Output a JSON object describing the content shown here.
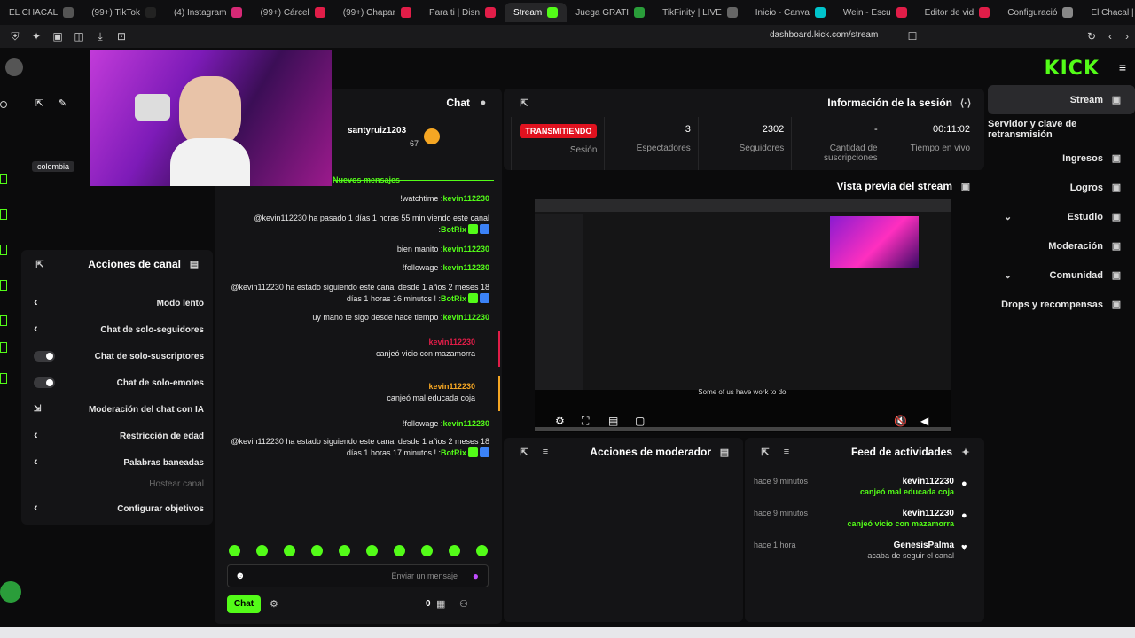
{
  "browser": {
    "tabs": [
      {
        "label": "EL CHACAL",
        "color": "#555555"
      },
      {
        "label": "(99+) TikTok",
        "color": "#222222"
      },
      {
        "label": "(4) Instagram",
        "color": "#d62976"
      },
      {
        "label": "(99+) Cárcel",
        "color": "#e11d48"
      },
      {
        "label": "(99+) Chapar",
        "color": "#e11d48"
      },
      {
        "label": "Para ti | Disn",
        "color": "#e11d48"
      },
      {
        "label": "Stream",
        "color": "#53fc18",
        "active": true
      },
      {
        "label": "Juega GRATI",
        "color": "#2a9d3a"
      },
      {
        "label": "TikFinity | LIVE",
        "color": "#666666"
      },
      {
        "label": "Inicio - Canva",
        "color": "#00c4cc"
      },
      {
        "label": "Wein - Escu",
        "color": "#e11d48"
      },
      {
        "label": "Editor de vid",
        "color": "#e11d48"
      },
      {
        "label": "Configuració",
        "color": "#888888"
      },
      {
        "label": "El Chacal | D",
        "color": "#888888"
      }
    ],
    "url": "dashboard.kick.com/stream"
  },
  "header": {
    "logo": "KICK"
  },
  "nav": {
    "items": [
      {
        "label": "Stream",
        "icon": "broadcast-icon",
        "active": true
      },
      {
        "label": "Servidor y clave de retransmisión",
        "icon": "",
        "active": false
      },
      {
        "label": "Ingresos",
        "icon": "money-icon"
      },
      {
        "label": "Logros",
        "icon": "trophy-icon"
      },
      {
        "label": "Estudio",
        "icon": "studio-icon",
        "chevron": true
      },
      {
        "label": "Moderación",
        "icon": "wrench-icon"
      },
      {
        "label": "Comunidad",
        "icon": "community-icon",
        "chevron": true
      },
      {
        "label": "Drops y recompensas",
        "icon": "gift-icon"
      }
    ]
  },
  "session": {
    "title": "Información de la sesión",
    "live_badge": "TRANSMITIENDO",
    "stats": [
      {
        "value": "",
        "label": "Sesión"
      },
      {
        "value": "3",
        "label": "Espectadores"
      },
      {
        "value": "2302",
        "label": "Seguidores"
      },
      {
        "value": "-",
        "label": "Cantidad de suscripciones"
      },
      {
        "value": "00:11:02",
        "label": "Tiempo en vivo"
      }
    ]
  },
  "preview": {
    "title": "Vista previa del stream",
    "caption": "Some of us have work to do."
  },
  "moderator": {
    "title": "Acciones de moderador"
  },
  "activity": {
    "title": "Feed de actividades",
    "items": [
      {
        "user": "kevin112230",
        "time": "hace 9 minutos",
        "message": "canjeó mal educada coja",
        "style": "green"
      },
      {
        "user": "kevin112230",
        "time": "hace 9 minutos",
        "message": "canjeó vicio con mazamorra",
        "style": "green"
      },
      {
        "user": "GenesisPalma",
        "time": "hace 1 hora",
        "message": "acaba de seguir el canal",
        "style": "grey"
      }
    ]
  },
  "chat": {
    "title": "Chat",
    "pinned_user": "santyruiz1203",
    "pinned_sub": "67",
    "new_messages": "Nuevos mensajes",
    "messages": [
      {
        "user": "kevin112230",
        "text": "!watchtime"
      },
      {
        "user": "BotRix",
        "text": "@kevin112230 ha pasado 1 días 1 horas 55 min viendo este canal",
        "bot": true
      },
      {
        "user": "kevin112230",
        "text": "bien manito"
      },
      {
        "user": "kevin112230",
        "text": "!followage"
      },
      {
        "user": "BotRix",
        "text": "@kevin112230 ha estado siguiendo este canal desde 1 años 2 meses 18 días 1 horas 16 minutos !",
        "bot": true
      },
      {
        "user": "kevin112230",
        "text": "uy mano te sigo desde hace tiempo"
      },
      {
        "user": "kevin112230",
        "text": "canjeó vicio con mazamorra",
        "highlight": "#e11d48"
      },
      {
        "user": "kevin112230",
        "text": "canjeó mal educada coja",
        "highlight": "#f5a623"
      },
      {
        "user": "kevin112230",
        "text": "!followage"
      },
      {
        "user": "BotRix",
        "text": "@kevin112230 ha estado siguiendo este canal desde 1 años 2 meses 18 días 1 horas 17 minutos !",
        "bot": true
      }
    ],
    "input_placeholder": "Enviar un mensaje",
    "send_label": "Chat",
    "points": "0"
  },
  "channel_actions": {
    "title": "Acciones de canal",
    "rows": [
      {
        "label": "Modo lento",
        "control": "chevron"
      },
      {
        "label": "Chat de solo-seguidores",
        "control": "chevron"
      },
      {
        "label": "Chat de solo-suscriptores",
        "control": "toggle"
      },
      {
        "label": "Chat de solo-emotes",
        "control": "toggle"
      },
      {
        "label": "Moderación del chat con IA",
        "control": "external"
      },
      {
        "label": "Restricción de edad",
        "control": "chevron"
      },
      {
        "label": "Palabras baneadas",
        "control": "chevron"
      },
      {
        "label": "Hostear canal",
        "control": "none",
        "muted": true
      },
      {
        "label": "Configurar objetivos",
        "control": "chevron"
      }
    ]
  },
  "webcam": {
    "overlay_label": "colombia"
  },
  "colors": {
    "accent": "#53fc18",
    "live": "#e0121f",
    "panel": "#141416",
    "bg": "#0b0b0c"
  }
}
